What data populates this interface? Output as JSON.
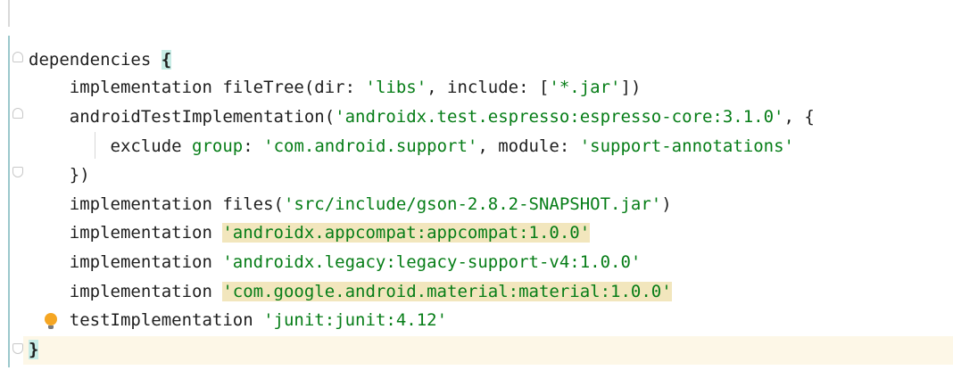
{
  "editor": {
    "lines": [
      {
        "parts": [
          {
            "t": "dependencies "
          },
          {
            "t": "{",
            "c": "brace-hl"
          }
        ]
      },
      {
        "parts": [
          {
            "t": "    implementation fileTree(dir: "
          },
          {
            "t": "'libs'",
            "c": "str"
          },
          {
            "t": ", include: ["
          },
          {
            "t": "'*.jar'",
            "c": "str"
          },
          {
            "t": "])"
          }
        ]
      },
      {
        "parts": [
          {
            "t": "    androidTestImplementation("
          },
          {
            "t": "'androidx.test.espresso:espresso-core:3.1.0'",
            "c": "str"
          },
          {
            "t": ", {"
          }
        ]
      },
      {
        "parts": [
          {
            "t": "        exclude "
          },
          {
            "t": "group",
            "c": "kw"
          },
          {
            "t": ": "
          },
          {
            "t": "'com.android.support'",
            "c": "str"
          },
          {
            "t": ", module: "
          },
          {
            "t": "'support-annotations'",
            "c": "str"
          }
        ]
      },
      {
        "parts": [
          {
            "t": "    })"
          }
        ]
      },
      {
        "parts": [
          {
            "t": "    implementation files("
          },
          {
            "t": "'src/include/gson-2.8.2-SNAPSHOT.jar'",
            "c": "str"
          },
          {
            "t": ")"
          }
        ]
      },
      {
        "parts": [
          {
            "t": "    implementation "
          },
          {
            "t": "'androidx.appcompat:appcompat:1.0.0'",
            "c": "str-hl"
          }
        ]
      },
      {
        "parts": [
          {
            "t": "    implementation "
          },
          {
            "t": "'androidx.legacy:legacy-support-v4:1.0.0'",
            "c": "str"
          }
        ]
      },
      {
        "parts": [
          {
            "t": "    implementation "
          },
          {
            "t": "'com.google.android.material:material:1.0.0'",
            "c": "str-hl"
          }
        ]
      },
      {
        "parts": [
          {
            "t": "    testImplementation "
          },
          {
            "t": "'junit:junit:4.12'",
            "c": "str"
          }
        ]
      },
      {
        "parts": [
          {
            "t": "}",
            "c": "brace-hl"
          }
        ]
      }
    ],
    "intention_icon": "lightbulb-icon"
  }
}
